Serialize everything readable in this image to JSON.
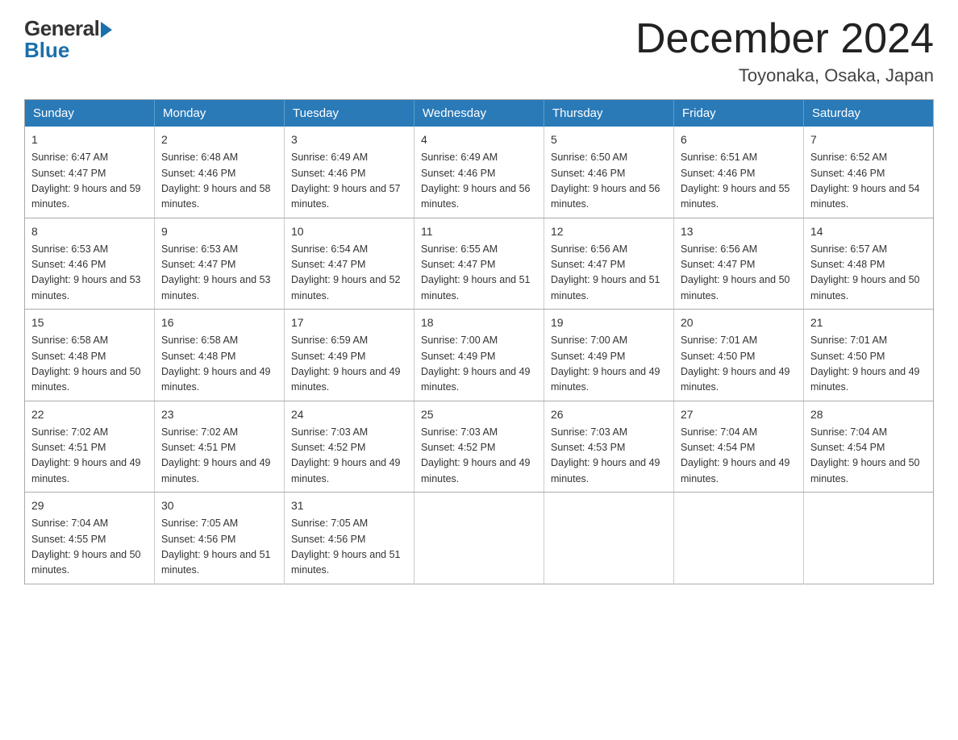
{
  "logo": {
    "general": "General",
    "blue": "Blue"
  },
  "header": {
    "month_year": "December 2024",
    "location": "Toyonaka, Osaka, Japan"
  },
  "weekdays": [
    "Sunday",
    "Monday",
    "Tuesday",
    "Wednesday",
    "Thursday",
    "Friday",
    "Saturday"
  ],
  "weeks": [
    [
      {
        "day": "1",
        "sunrise": "6:47 AM",
        "sunset": "4:47 PM",
        "daylight": "9 hours and 59 minutes."
      },
      {
        "day": "2",
        "sunrise": "6:48 AM",
        "sunset": "4:46 PM",
        "daylight": "9 hours and 58 minutes."
      },
      {
        "day": "3",
        "sunrise": "6:49 AM",
        "sunset": "4:46 PM",
        "daylight": "9 hours and 57 minutes."
      },
      {
        "day": "4",
        "sunrise": "6:49 AM",
        "sunset": "4:46 PM",
        "daylight": "9 hours and 56 minutes."
      },
      {
        "day": "5",
        "sunrise": "6:50 AM",
        "sunset": "4:46 PM",
        "daylight": "9 hours and 56 minutes."
      },
      {
        "day": "6",
        "sunrise": "6:51 AM",
        "sunset": "4:46 PM",
        "daylight": "9 hours and 55 minutes."
      },
      {
        "day": "7",
        "sunrise": "6:52 AM",
        "sunset": "4:46 PM",
        "daylight": "9 hours and 54 minutes."
      }
    ],
    [
      {
        "day": "8",
        "sunrise": "6:53 AM",
        "sunset": "4:46 PM",
        "daylight": "9 hours and 53 minutes."
      },
      {
        "day": "9",
        "sunrise": "6:53 AM",
        "sunset": "4:47 PM",
        "daylight": "9 hours and 53 minutes."
      },
      {
        "day": "10",
        "sunrise": "6:54 AM",
        "sunset": "4:47 PM",
        "daylight": "9 hours and 52 minutes."
      },
      {
        "day": "11",
        "sunrise": "6:55 AM",
        "sunset": "4:47 PM",
        "daylight": "9 hours and 51 minutes."
      },
      {
        "day": "12",
        "sunrise": "6:56 AM",
        "sunset": "4:47 PM",
        "daylight": "9 hours and 51 minutes."
      },
      {
        "day": "13",
        "sunrise": "6:56 AM",
        "sunset": "4:47 PM",
        "daylight": "9 hours and 50 minutes."
      },
      {
        "day": "14",
        "sunrise": "6:57 AM",
        "sunset": "4:48 PM",
        "daylight": "9 hours and 50 minutes."
      }
    ],
    [
      {
        "day": "15",
        "sunrise": "6:58 AM",
        "sunset": "4:48 PM",
        "daylight": "9 hours and 50 minutes."
      },
      {
        "day": "16",
        "sunrise": "6:58 AM",
        "sunset": "4:48 PM",
        "daylight": "9 hours and 49 minutes."
      },
      {
        "day": "17",
        "sunrise": "6:59 AM",
        "sunset": "4:49 PM",
        "daylight": "9 hours and 49 minutes."
      },
      {
        "day": "18",
        "sunrise": "7:00 AM",
        "sunset": "4:49 PM",
        "daylight": "9 hours and 49 minutes."
      },
      {
        "day": "19",
        "sunrise": "7:00 AM",
        "sunset": "4:49 PM",
        "daylight": "9 hours and 49 minutes."
      },
      {
        "day": "20",
        "sunrise": "7:01 AM",
        "sunset": "4:50 PM",
        "daylight": "9 hours and 49 minutes."
      },
      {
        "day": "21",
        "sunrise": "7:01 AM",
        "sunset": "4:50 PM",
        "daylight": "9 hours and 49 minutes."
      }
    ],
    [
      {
        "day": "22",
        "sunrise": "7:02 AM",
        "sunset": "4:51 PM",
        "daylight": "9 hours and 49 minutes."
      },
      {
        "day": "23",
        "sunrise": "7:02 AM",
        "sunset": "4:51 PM",
        "daylight": "9 hours and 49 minutes."
      },
      {
        "day": "24",
        "sunrise": "7:03 AM",
        "sunset": "4:52 PM",
        "daylight": "9 hours and 49 minutes."
      },
      {
        "day": "25",
        "sunrise": "7:03 AM",
        "sunset": "4:52 PM",
        "daylight": "9 hours and 49 minutes."
      },
      {
        "day": "26",
        "sunrise": "7:03 AM",
        "sunset": "4:53 PM",
        "daylight": "9 hours and 49 minutes."
      },
      {
        "day": "27",
        "sunrise": "7:04 AM",
        "sunset": "4:54 PM",
        "daylight": "9 hours and 49 minutes."
      },
      {
        "day": "28",
        "sunrise": "7:04 AM",
        "sunset": "4:54 PM",
        "daylight": "9 hours and 50 minutes."
      }
    ],
    [
      {
        "day": "29",
        "sunrise": "7:04 AM",
        "sunset": "4:55 PM",
        "daylight": "9 hours and 50 minutes."
      },
      {
        "day": "30",
        "sunrise": "7:05 AM",
        "sunset": "4:56 PM",
        "daylight": "9 hours and 51 minutes."
      },
      {
        "day": "31",
        "sunrise": "7:05 AM",
        "sunset": "4:56 PM",
        "daylight": "9 hours and 51 minutes."
      },
      null,
      null,
      null,
      null
    ]
  ]
}
